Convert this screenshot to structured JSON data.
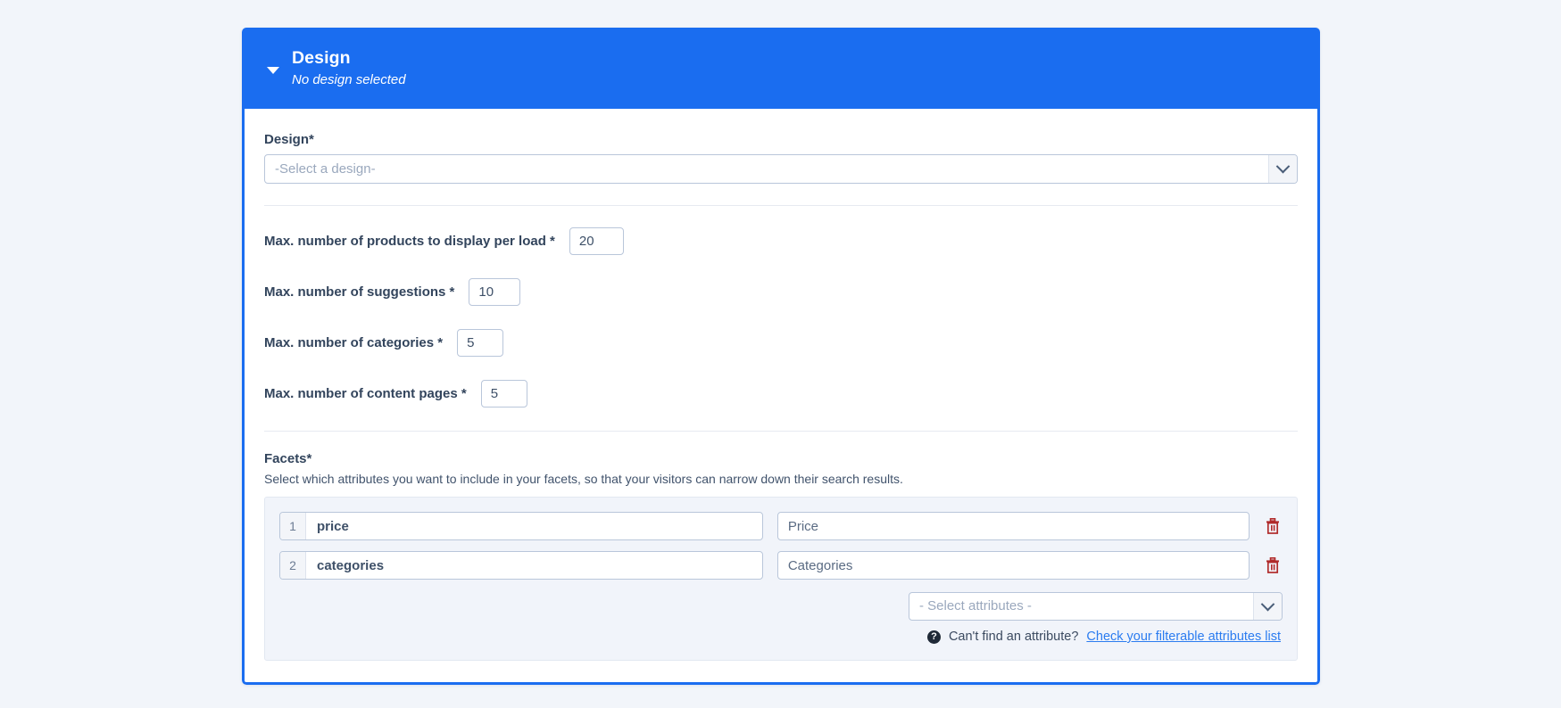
{
  "theme": {
    "accent": "#1a6df0",
    "page_bg": "#f2f5fa",
    "panel_bg": "#f1f4fa",
    "label_color": "#32445c",
    "link_color": "#2b7cf0",
    "delete_icon_color": "#b02a2a"
  },
  "header": {
    "title": "Design",
    "subtitle": "No design selected",
    "collapse_icon": "caret-down-icon"
  },
  "design": {
    "label": "Design*",
    "select_value": "-Select a design-",
    "select_options": [
      "-Select a design-"
    ],
    "dropdown_icon": "chevron-down-icon"
  },
  "numeric_fields": [
    {
      "label": "Max. number of products to display per load *",
      "value": "20",
      "name": "max-products-per-load"
    },
    {
      "label": "Max. number of suggestions *",
      "value": "10",
      "name": "max-suggestions"
    },
    {
      "label": "Max. number of categories *",
      "value": "5",
      "name": "max-categories"
    },
    {
      "label": "Max. number of content pages *",
      "value": "5",
      "name": "max-content-pages"
    }
  ],
  "facets": {
    "title": "Facets*",
    "help_text": "Select which attributes you want to include in your facets, so that your visitors can narrow down their search results.",
    "rows": [
      {
        "index": "1",
        "attribute": "price",
        "label": "Price",
        "delete_icon": "trash-icon"
      },
      {
        "index": "2",
        "attribute": "categories",
        "label": "Categories",
        "delete_icon": "trash-icon"
      }
    ],
    "attribute_select_value": "- Select attributes -",
    "attribute_select_options": [
      "- Select attributes -"
    ],
    "footer": {
      "help_icon": "question-mark-icon",
      "question": "Can't find an attribute?",
      "link": "Check your filterable attributes list"
    }
  }
}
